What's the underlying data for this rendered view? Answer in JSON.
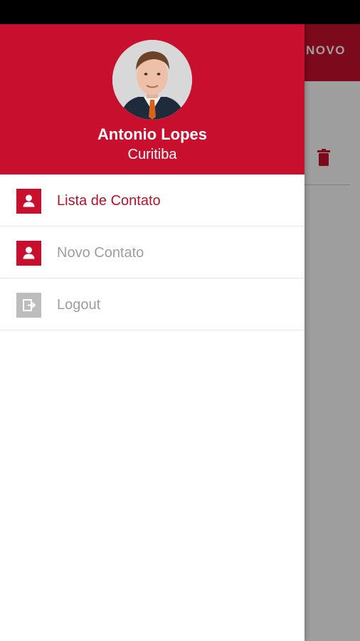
{
  "background_screen": {
    "toolbar_action": "NOVO",
    "icons": {
      "delete": "trash-icon"
    }
  },
  "drawer": {
    "header": {
      "user_name": "Antonio Lopes",
      "user_city": "Curitiba",
      "avatar_icon": "user-photo"
    },
    "menu": [
      {
        "label": "Lista de Contato",
        "icon": "contact-person-icon",
        "active": true
      },
      {
        "label": "Novo Contato",
        "icon": "contact-person-icon",
        "active": false
      },
      {
        "label": "Logout",
        "icon": "logout-icon",
        "active": false
      }
    ]
  },
  "colors": {
    "primary": "#c8102e",
    "active_text": "#b5122b",
    "inactive_text": "#9e9e9e",
    "logout_icon": "#bdbdbd"
  }
}
